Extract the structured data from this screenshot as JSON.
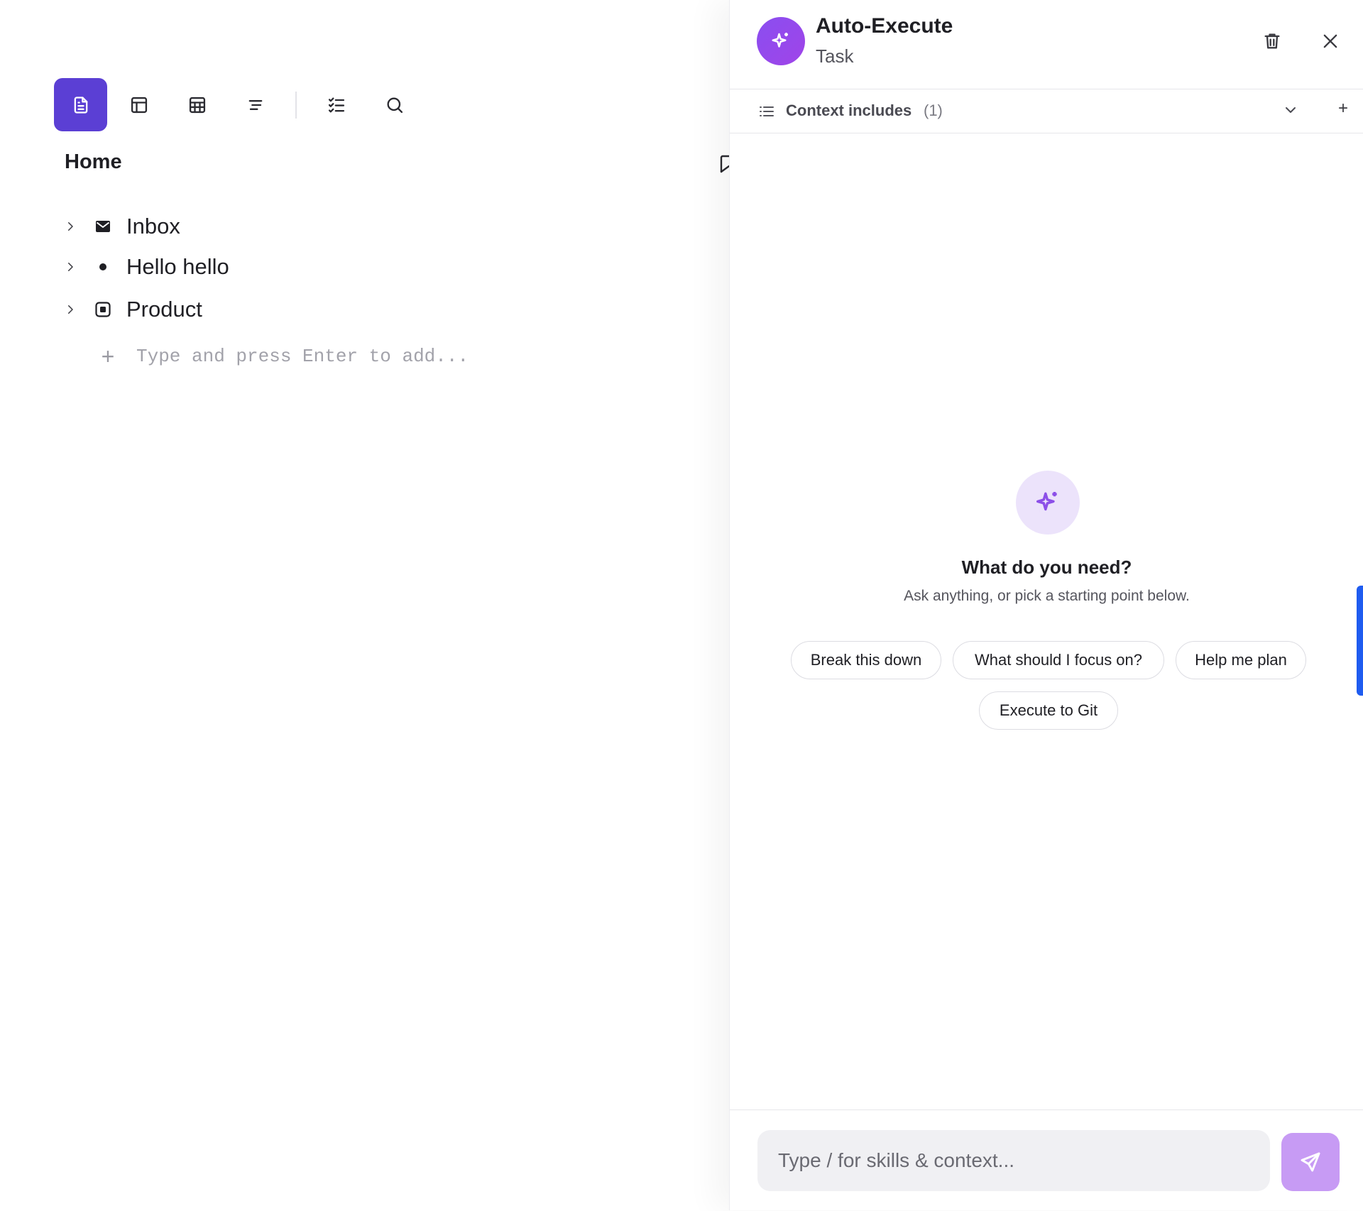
{
  "page": {
    "title": "Home"
  },
  "toolbar": {
    "buttons": [
      {
        "icon": "document-icon",
        "active": true
      },
      {
        "icon": "layout-icon",
        "active": false
      },
      {
        "icon": "table-icon",
        "active": false
      },
      {
        "icon": "outline-icon",
        "active": false
      },
      {
        "icon": "checklist-icon",
        "active": false
      },
      {
        "icon": "search-icon",
        "active": false
      }
    ],
    "accent": "#5b3fd4"
  },
  "tree": {
    "items": [
      {
        "label": "Inbox",
        "icon": "mail-icon"
      },
      {
        "label": "Hello hello",
        "icon": "bullet-icon"
      },
      {
        "label": "Product",
        "icon": "square-dot-icon"
      }
    ],
    "add_placeholder": "Type and press Enter to add..."
  },
  "panel": {
    "title": "Auto-Execute",
    "subtitle": "Task",
    "context": {
      "label": "Context includes",
      "count": "(1)"
    },
    "empty_state": {
      "title": "What do you need?",
      "subtitle": "Ask anything, or pick a starting point below."
    },
    "suggestions": [
      "Break this down",
      "What should I focus on?",
      "Help me plan",
      "Execute to Git"
    ],
    "composer": {
      "placeholder": "Type / for skills & context..."
    },
    "colors": {
      "avatar": "#8a4ef0",
      "spark_bg": "#ece3fb",
      "send": "#c79bf4",
      "edge_tab": "#1f5cf0"
    }
  }
}
